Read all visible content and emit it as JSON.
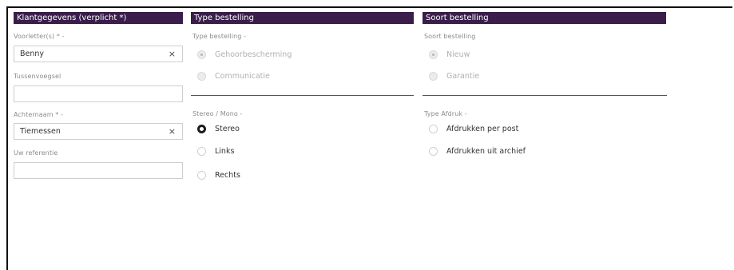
{
  "klant": {
    "header": "Klantgegevens (verplicht *)",
    "voorletters_label": "Voorletter(s) * -",
    "voorletters_value": "Benny",
    "tussenvoegsel_label": "Tussenvoegsel",
    "tussenvoegsel_value": "",
    "achternaam_label": "Achternaam * -",
    "achternaam_value": "Tiemessen",
    "referentie_label": "Uw referentie",
    "referentie_value": "",
    "clear_glyph": "×"
  },
  "type": {
    "header": "Type bestelling",
    "type_label": "Type bestelling -",
    "type_options": [
      {
        "label": "Gehoorbescherming",
        "checked": true
      },
      {
        "label": "Communicatie",
        "checked": false
      }
    ],
    "stereo_label": "Stereo / Mono -",
    "stereo_options": [
      {
        "label": "Stereo",
        "checked": true
      },
      {
        "label": "Links",
        "checked": false
      },
      {
        "label": "Rechts",
        "checked": false
      }
    ]
  },
  "soort": {
    "header": "Soort bestelling",
    "soort_label": "Soort bestelling",
    "soort_options": [
      {
        "label": "Nieuw",
        "checked": true
      },
      {
        "label": "Garantie",
        "checked": false
      }
    ],
    "afdruk_label": "Type Afdruk -",
    "afdruk_options": [
      {
        "label": "Afdrukken per post",
        "checked": false
      },
      {
        "label": "Afdrukken uit archief",
        "checked": false
      }
    ]
  }
}
